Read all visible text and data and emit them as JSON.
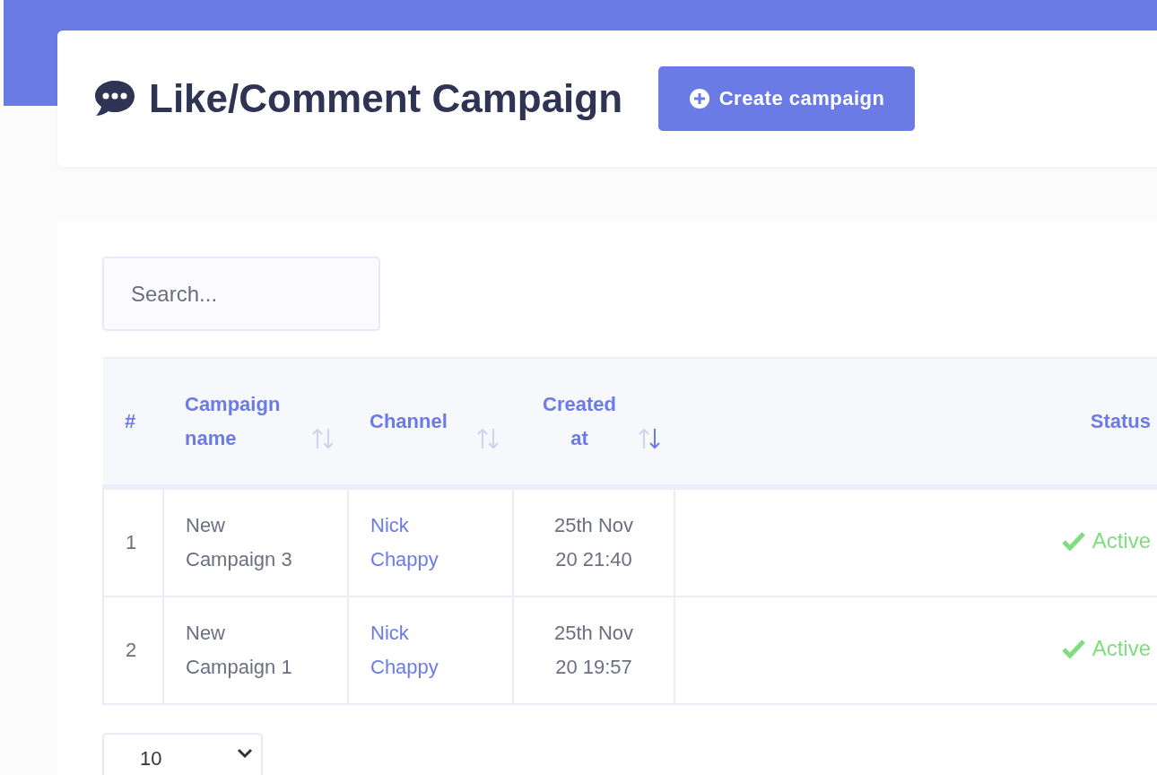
{
  "header": {
    "title": "Like/Comment Campaign",
    "create_button": "Create campaign"
  },
  "search": {
    "placeholder": "Search..."
  },
  "table": {
    "columns": [
      {
        "label": "#"
      },
      {
        "label": "Campaign name",
        "sorted_desc": false
      },
      {
        "label": "Channel",
        "sorted_desc": false
      },
      {
        "label": "Created at",
        "sorted_desc": true
      },
      {
        "label": "Status"
      }
    ],
    "rows": [
      {
        "index": "1",
        "name": "New Campaign 3",
        "channel": "Nick Chappy",
        "created": "25th Nov 20 21:40",
        "status": "Active",
        "active": true
      },
      {
        "index": "2",
        "name": "New Campaign 1",
        "channel": "Nick Chappy",
        "created": "25th Nov 20 19:57",
        "status": "Active",
        "active": true
      }
    ]
  },
  "page_size": {
    "value": "10"
  }
}
